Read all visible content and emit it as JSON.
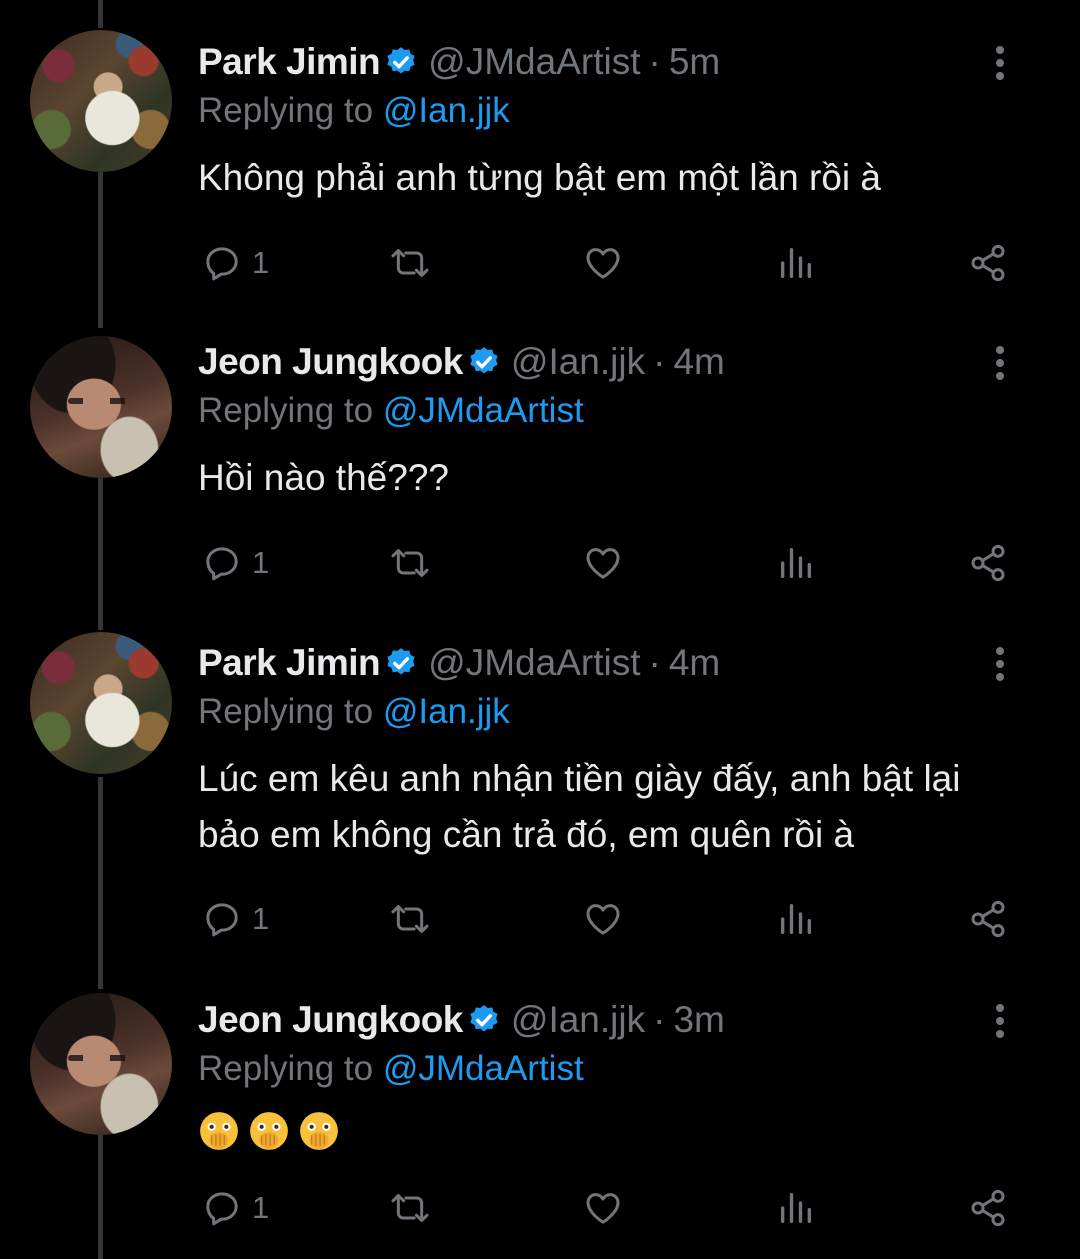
{
  "colors": {
    "background": "#000000",
    "text": "#e7e9ea",
    "muted": "#71767b",
    "accent": "#1d9bf0",
    "thread_line": "#333639"
  },
  "tweets": [
    {
      "author": "Park Jimin",
      "handle": "@JMdaArtist",
      "separator": "·",
      "time": "5m",
      "replying_prefix": "Replying to",
      "replying_to": "@Ian.jjk",
      "text": "Không phải anh từng bật em một lần rồi à",
      "reply_count": "1",
      "avatar": "jimin-avatar"
    },
    {
      "author": "Jeon Jungkook",
      "handle": "@Ian.jjk",
      "separator": "·",
      "time": "4m",
      "replying_prefix": "Replying to",
      "replying_to": "@JMdaArtist",
      "text": "Hồi nào thế???",
      "reply_count": "1",
      "avatar": "jungkook-avatar"
    },
    {
      "author": "Park Jimin",
      "handle": "@JMdaArtist",
      "separator": "·",
      "time": "4m",
      "replying_prefix": "Replying to",
      "replying_to": "@Ian.jjk",
      "text": "Lúc em kêu anh nhận tiền giày đấy, anh bật lại bảo em không cần trả đó, em quên rồi à",
      "reply_count": "1",
      "avatar": "jimin-avatar"
    },
    {
      "author": "Jeon Jungkook",
      "handle": "@Ian.jjk",
      "separator": "·",
      "time": "3m",
      "replying_prefix": "Replying to",
      "replying_to": "@JMdaArtist",
      "text": "",
      "emoji": [
        "face-with-open-eyes-and-hand-over-mouth",
        "face-with-open-eyes-and-hand-over-mouth",
        "face-with-open-eyes-and-hand-over-mouth"
      ],
      "reply_count": "1",
      "avatar": "jungkook-avatar"
    }
  ],
  "icons": {
    "verified": "verified-badge-icon",
    "more": "more-vertical-icon",
    "reply": "reply-icon",
    "retweet": "retweet-icon",
    "like": "heart-icon",
    "views": "views-icon",
    "share": "share-icon"
  }
}
